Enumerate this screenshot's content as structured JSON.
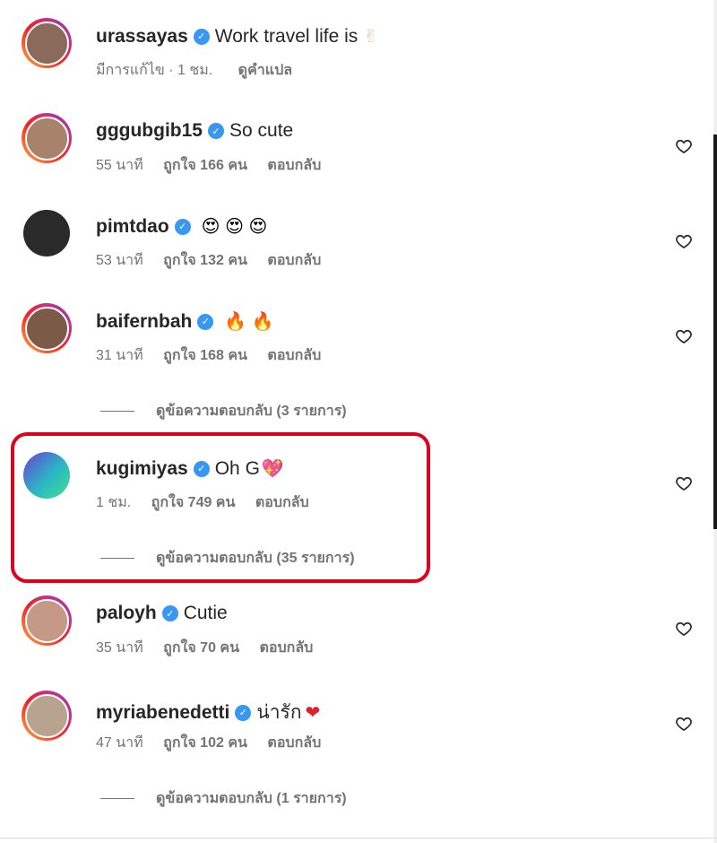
{
  "comments": [
    {
      "username": "urassayas",
      "text": "Work travel life is",
      "emoji": "✌",
      "time": "มีการแก้ไข · 1 ชม.",
      "likes": "",
      "reply": "",
      "translate": "ดูคำแปล",
      "avatar_color": "#8a6a5a",
      "has_like": false,
      "replies": ""
    },
    {
      "username": "gggubgib15",
      "text": "So cute",
      "emoji": "",
      "time": "55 นาที",
      "likes": "ถูกใจ 166 คน",
      "reply": "ตอบกลับ",
      "avatar_color": "#a8826a",
      "has_like": true,
      "replies": ""
    },
    {
      "username": "pimtdao",
      "text": "",
      "emoji": "😍 😍 😍",
      "time": "53 นาที",
      "likes": "ถูกใจ 132 คน",
      "reply": "ตอบกลับ",
      "avatar_color": "#2a2a2a",
      "has_like": true,
      "replies": ""
    },
    {
      "username": "baifernbah",
      "text": "",
      "emoji": "🔥 🔥",
      "time": "31 นาที",
      "likes": "ถูกใจ 168 คน",
      "reply": "ตอบกลับ",
      "avatar_color": "#7c5a48",
      "has_like": true,
      "replies": "ดูข้อความตอบกลับ (3 รายการ)"
    },
    {
      "username": "kugimiyas",
      "text": "Oh G",
      "emoji": "💖",
      "time": "1 ชม.",
      "likes": "ถูกใจ 749 คน",
      "reply": "ตอบกลับ",
      "avatar_color": "#2ab7c4",
      "has_like": true,
      "replies": "ดูข้อความตอบกลับ (35 รายการ)"
    },
    {
      "username": "paloyh",
      "text": "Cutie",
      "emoji": "",
      "time": "35 นาที",
      "likes": "ถูกใจ 70 คน",
      "reply": "ตอบกลับ",
      "avatar_color": "#c49a86",
      "has_like": true,
      "replies": ""
    },
    {
      "username": "myriabenedetti",
      "text": "น่ารัก",
      "emoji": "❤",
      "time": "47 นาที",
      "likes": "ถูกใจ 102 คน",
      "reply": "ตอบกลับ",
      "avatar_color": "#b8a48e",
      "has_like": true,
      "replies": "ดูข้อความตอบกลับ (1 รายการ)"
    }
  ],
  "icons": {
    "verified": "verified-badge-icon",
    "like": "heart-outline-icon"
  },
  "colors": {
    "highlight": "#e0001b",
    "badge": "#3897f0",
    "muted": "#737373"
  }
}
